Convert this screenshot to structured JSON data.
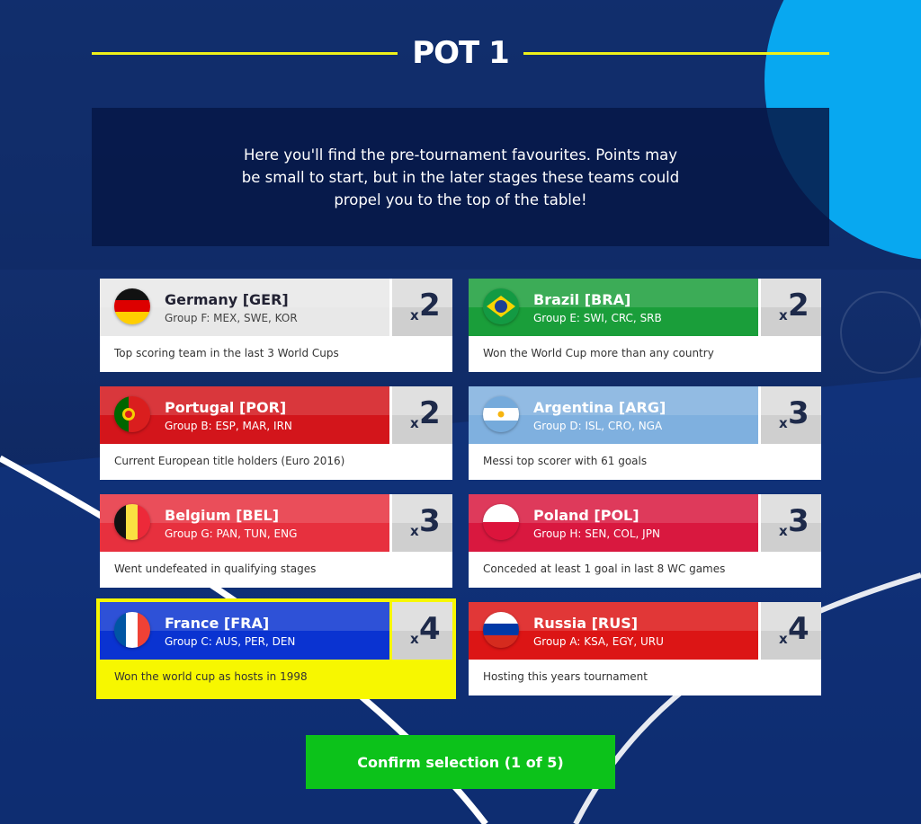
{
  "page": {
    "title": "POT 1",
    "intro": "Here you'll find the pre-tournament favourites. Points may be small to start, but in the later stages these teams could propel you to the top of the table!",
    "confirm_label": "Confirm selection (1 of 5)"
  },
  "colors": {
    "accent_line": "#eef11a",
    "selected": "#f7f700",
    "confirm": "#0cc21a"
  },
  "teams": [
    {
      "name": "Germany [GER]",
      "group": "Group F: MEX, SWE, KOR",
      "multiplier": "2",
      "x": "x",
      "fact": "Top scoring team in the last 3 World Cups",
      "color": "#e8e8e8",
      "flag": "germany-flag-icon"
    },
    {
      "name": "Brazil [BRA]",
      "group": "Group E: SWI, CRC, SRB",
      "multiplier": "2",
      "x": "x",
      "fact": "Won the World Cup more than any country",
      "color": "#1a9e3a",
      "flag": "brazil-flag-icon"
    },
    {
      "name": "Portugal [POR]",
      "group": "Group B: ESP, MAR, IRN",
      "multiplier": "2",
      "x": "x",
      "fact": "Current European title holders (Euro 2016)",
      "color": "#d3151b",
      "flag": "portugal-flag-icon"
    },
    {
      "name": "Argentina [ARG]",
      "group": "Group D: ISL, CRO, NGA",
      "multiplier": "3",
      "x": "x",
      "fact": "Messi top scorer with 61 goals",
      "color": "#7fb0df",
      "flag": "argentina-flag-icon"
    },
    {
      "name": "Belgium [BEL]",
      "group": "Group G: PAN, TUN, ENG",
      "multiplier": "3",
      "x": "x",
      "fact": "Went undefeated in qualifying stages",
      "color": "#e7303e",
      "flag": "belgium-flag-icon"
    },
    {
      "name": "Poland [POL]",
      "group": "Group H: SEN, COL, JPN",
      "multiplier": "3",
      "x": "x",
      "fact": "Conceded at least 1 goal in last 8 WC games",
      "color": "#d9183f",
      "flag": "poland-flag-icon"
    },
    {
      "name": "France [FRA]",
      "group": "Group C: AUS, PER, DEN",
      "multiplier": "4",
      "x": "x",
      "fact": "Won the world cup as hosts in 1998",
      "color": "#0a33d1",
      "flag": "france-flag-icon",
      "selected": true
    },
    {
      "name": "Russia [RUS]",
      "group": "Group A: KSA, EGY, URU",
      "multiplier": "4",
      "x": "x",
      "fact": "Hosting this years tournament",
      "color": "#dc1515",
      "flag": "russia-flag-icon"
    }
  ]
}
